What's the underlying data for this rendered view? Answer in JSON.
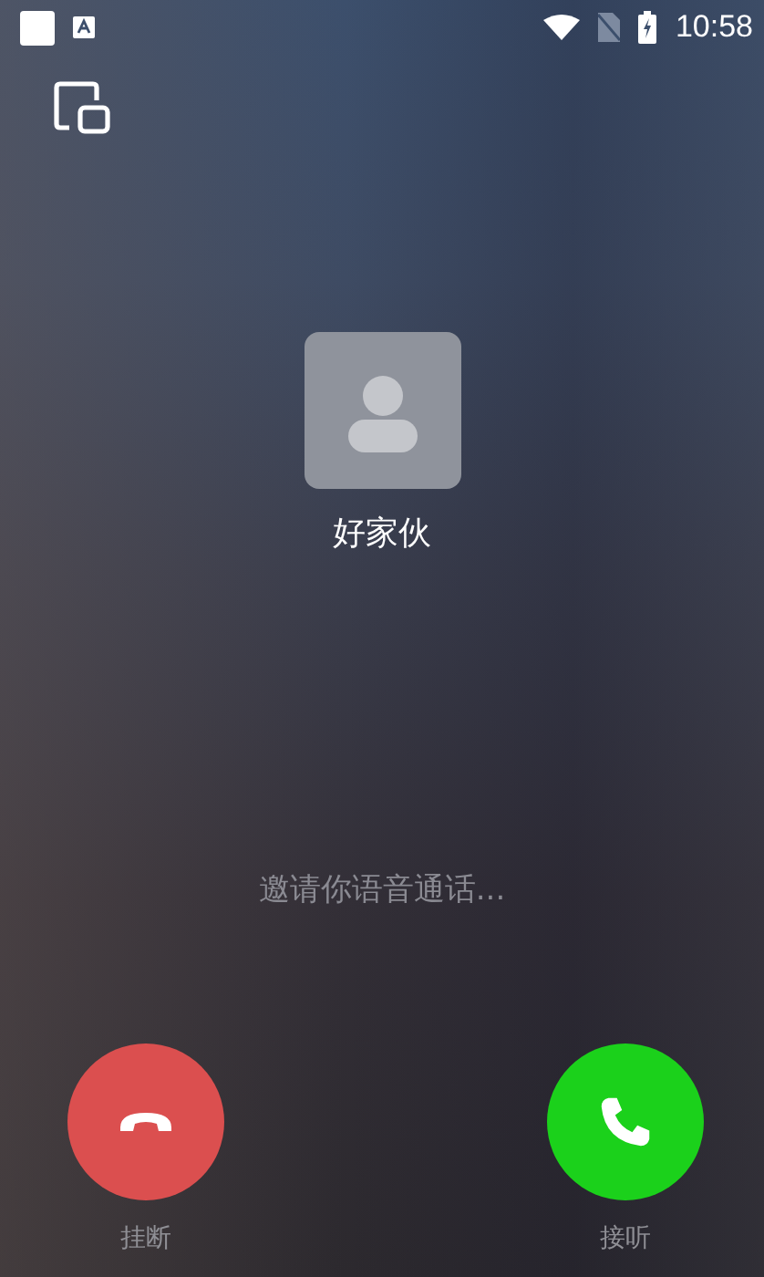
{
  "status_bar": {
    "time": "10:58"
  },
  "caller": {
    "name": "好家伙"
  },
  "message": "邀请你语音通话...",
  "actions": [
    {
      "kind": "decline",
      "label": "挂断"
    },
    {
      "kind": "accept",
      "label": "接听"
    }
  ]
}
